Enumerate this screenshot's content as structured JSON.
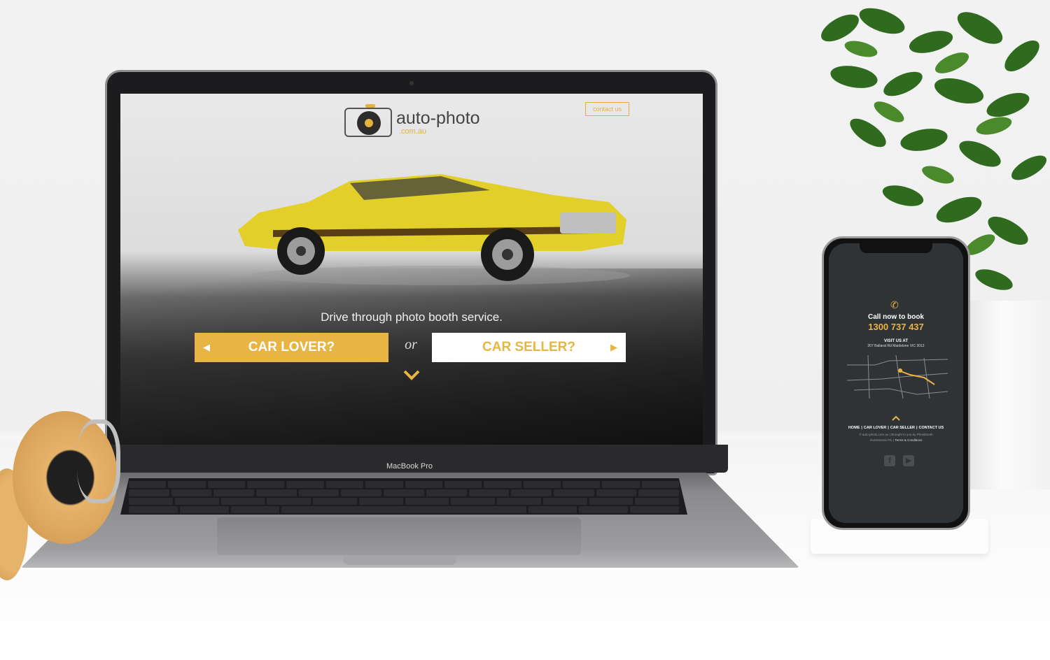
{
  "website": {
    "logo": {
      "name": "auto-photo",
      "domain": ".com.au"
    },
    "header": {
      "contact_label": "contact us"
    },
    "hero": {
      "tagline": "Drive through photo booth service.",
      "primary_cta": "CAR LOVER?",
      "separator": "or",
      "secondary_cta": "CAR SELLER?"
    }
  },
  "laptop": {
    "brand_label": "MacBook Pro"
  },
  "mobile": {
    "call_label": "Call now to book",
    "phone_number": "1300 737 437",
    "visit_label": "VISIT US AT",
    "address": "207 Ballarat Rd Maidstone VIC 3012",
    "footer_nav": [
      "HOME",
      "CAR LOVER",
      "CAR SELLER",
      "CONTACT US"
    ],
    "copyright_line1": "© auto-photo.com.au | Brought to you by Photobooth",
    "copyright_line2": "Investments P/L",
    "terms_label": "Terms & Conditions"
  },
  "colors": {
    "accent": "#e8b545",
    "phone_bg": "#2f3336",
    "logo_text": "#444444"
  },
  "icons": [
    "camera-wheel-logo-icon",
    "left-arrow-icon",
    "right-arrow-icon",
    "chevron-down-icon",
    "phone-icon",
    "chevron-up-icon",
    "facebook-icon",
    "youtube-icon"
  ]
}
